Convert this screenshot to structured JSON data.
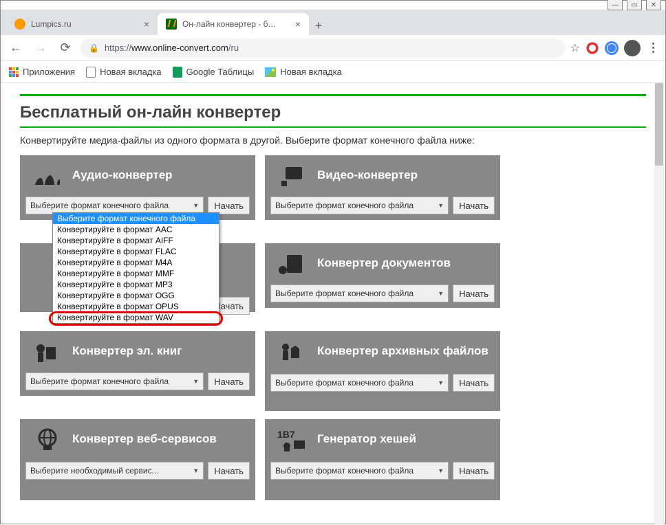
{
  "window": {
    "minimize": "—",
    "maximize": "▭",
    "close": "✕"
  },
  "tabs": [
    {
      "title": "Lumpics.ru"
    },
    {
      "title": "Он-лайн конвертер - бесплатно"
    }
  ],
  "newtab": "+",
  "addr": {
    "proto": "https://",
    "host": "www.online-convert.com",
    "path": "/ru"
  },
  "bookmarks": {
    "apps": "Приложения",
    "new1": "Новая вкладка",
    "sheets": "Google Таблицы",
    "new2": "Новая вкладка"
  },
  "page": {
    "heading": "Бесплатный он-лайн конвертер",
    "subtitle": "Конвертируйте медиа-файлы из одного формата в другой. Выберите формат конечного файла ниже:",
    "select_default": "Выберите формат конечного файла",
    "select_service": "Выберите необходимый сервис...",
    "start": "Начать"
  },
  "cards": {
    "audio": "Аудио-конвертер",
    "video": "Видео-конвертер",
    "docs": "Конвертер документов",
    "ebook": "Конвертер эл. книг",
    "archive": "Конвертер архивных файлов",
    "web": "Конвертер веб-сервисов",
    "hash": "Генератор хешей"
  },
  "dropdown": [
    "Выберите формат конечного файла",
    "Конвертируйте в формат AAC",
    "Конвертируйте в формат AIFF",
    "Конвертируйте в формат FLAC",
    "Конвертируйте в формат M4A",
    "Конвертируйте в формат MMF",
    "Конвертируйте в формат MP3",
    "Конвертируйте в формат OGG",
    "Конвертируйте в формат OPUS",
    "Конвертируйте в формат WAV"
  ]
}
